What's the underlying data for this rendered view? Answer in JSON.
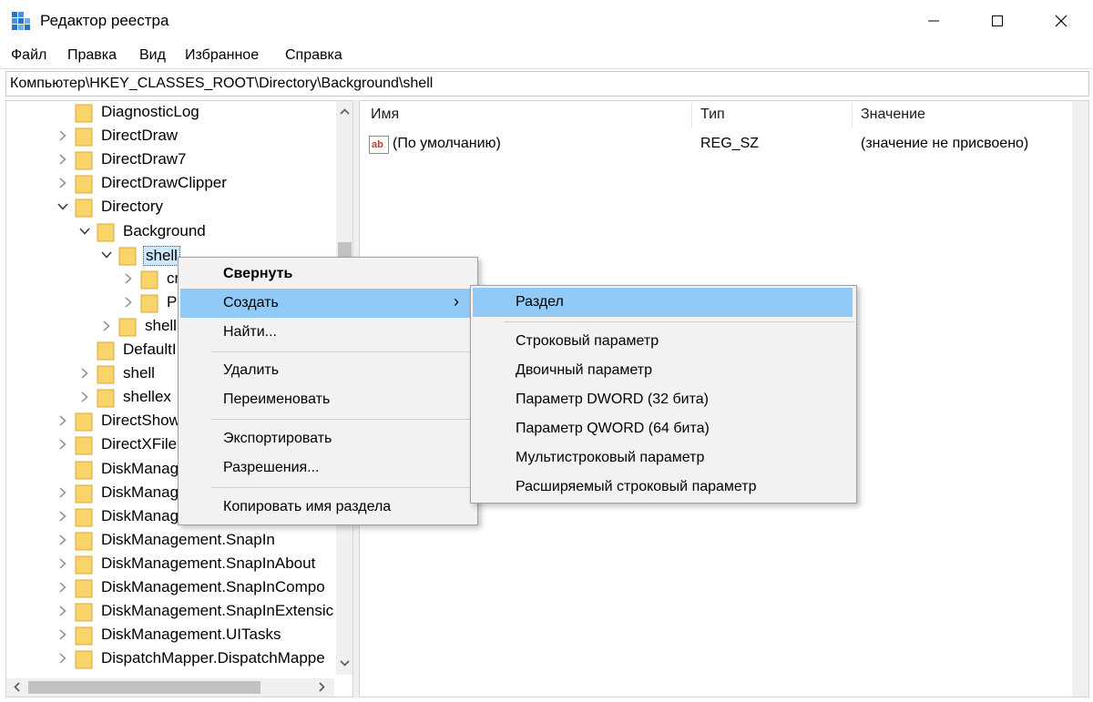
{
  "window": {
    "title": "Редактор реестра",
    "controls": [
      "minimize",
      "maximize",
      "close"
    ]
  },
  "menubar": {
    "items": [
      "Файл",
      "Правка",
      "Вид",
      "Избранное",
      "Справка"
    ]
  },
  "address": {
    "path": "Компьютер\\HKEY_CLASSES_ROOT\\Directory\\Background\\shell"
  },
  "tree": {
    "items": [
      {
        "label": "DiagnosticLog",
        "expander": "none"
      },
      {
        "label": "DirectDraw",
        "expander": "collapsed"
      },
      {
        "label": "DirectDraw7",
        "expander": "collapsed"
      },
      {
        "label": "DirectDrawClipper",
        "expander": "collapsed"
      },
      {
        "label": "Directory",
        "expander": "expanded"
      },
      {
        "label": "Background",
        "expander": "expanded"
      },
      {
        "label": "shell",
        "expander": "expanded",
        "selected": true
      },
      {
        "label": "cr",
        "expander": "collapsed"
      },
      {
        "label": "P",
        "expander": "collapsed"
      },
      {
        "label": "shell",
        "expander": "collapsed"
      },
      {
        "label": "DefaultI",
        "expander": "none"
      },
      {
        "label": "shell",
        "expander": "collapsed"
      },
      {
        "label": "shellex",
        "expander": "collapsed"
      },
      {
        "label": "DirectShow",
        "expander": "collapsed"
      },
      {
        "label": "DirectXFile",
        "expander": "collapsed"
      },
      {
        "label": "DiskManag",
        "expander": "none"
      },
      {
        "label": "DiskManag",
        "expander": "collapsed"
      },
      {
        "label": "DiskManag",
        "expander": "collapsed"
      },
      {
        "label": "DiskManagement.SnapIn",
        "expander": "collapsed"
      },
      {
        "label": "DiskManagement.SnapInAbout",
        "expander": "collapsed"
      },
      {
        "label": "DiskManagement.SnapInCompo",
        "expander": "collapsed"
      },
      {
        "label": "DiskManagement.SnapInExtensic",
        "expander": "collapsed"
      },
      {
        "label": "DiskManagement.UITasks",
        "expander": "collapsed"
      },
      {
        "label": "DispatchMapper.DispatchMappe",
        "expander": "collapsed"
      }
    ]
  },
  "list": {
    "columns": [
      "Имя",
      "Тип",
      "Значение"
    ],
    "rows": [
      {
        "name": "(По умолчанию)",
        "type": "REG_SZ",
        "value": "(значение не присвоено)"
      }
    ]
  },
  "context_menu": {
    "collapse": "Свернуть",
    "new": "Создать",
    "find": "Найти...",
    "delete": "Удалить",
    "rename": "Переименовать",
    "export": "Экспортировать",
    "permissions": "Разрешения...",
    "copy_key_name": "Копировать имя раздела",
    "submenu_arrow": "›"
  },
  "submenu": {
    "key": "Раздел",
    "string_value": "Строковый параметр",
    "binary_value": "Двоичный параметр",
    "dword_value": "Параметр DWORD (32 бита)",
    "qword_value": "Параметр QWORD (64 бита)",
    "multi_string_value": "Мультистроковый параметр",
    "expandable_string_value": "Расширяемый строковый параметр"
  },
  "colors": {
    "menu_highlight": "#91c9f7",
    "folder": "#f9d46b",
    "selection": "#cce8ff"
  }
}
